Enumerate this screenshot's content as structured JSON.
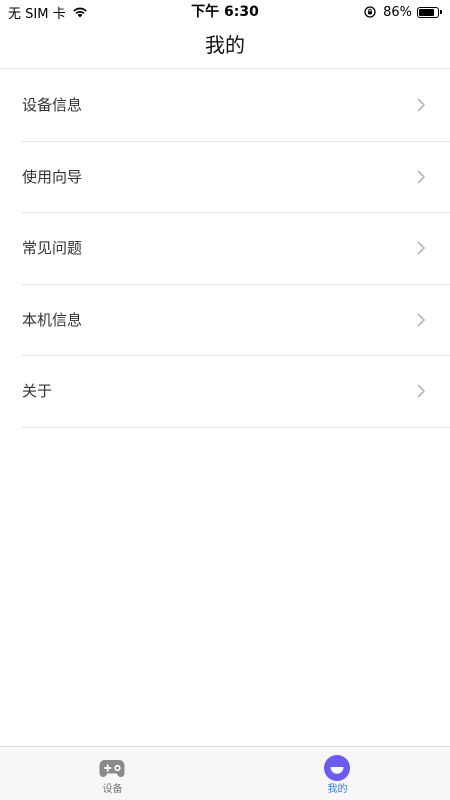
{
  "status_bar": {
    "carrier": "无 SIM 卡",
    "time": "下午 6:30",
    "battery_percent": "86%",
    "battery_level": 0.86
  },
  "header": {
    "title": "我的"
  },
  "menu": {
    "items": [
      {
        "label": "设备信息"
      },
      {
        "label": "使用向导"
      },
      {
        "label": "常见问题"
      },
      {
        "label": "本机信息"
      },
      {
        "label": "关于"
      }
    ]
  },
  "tab_bar": {
    "tabs": [
      {
        "label": "设备",
        "icon": "gamepad-icon",
        "active": false
      },
      {
        "label": "我的",
        "icon": "smile-face-icon",
        "active": true
      }
    ],
    "active_color": "#2f7df6",
    "inactive_color": "#777777"
  },
  "colors": {
    "icon_active_purple": "#6a5cf0",
    "icon_inactive_gray": "#8a8a8a",
    "divider": "#e3e3e3"
  }
}
